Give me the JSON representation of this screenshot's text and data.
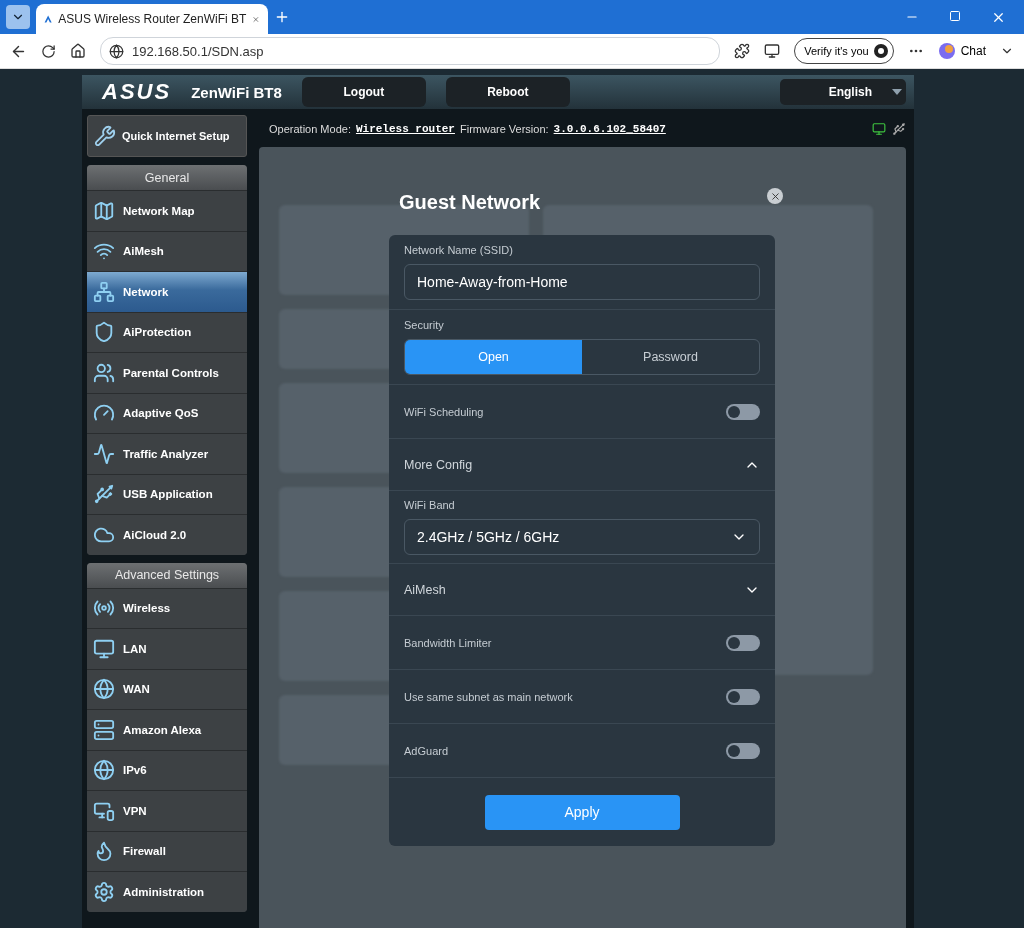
{
  "browser": {
    "tab_title": "ASUS Wireless Router ZenWiFi BT",
    "url": "192.168.50.1/SDN.asp",
    "verify": "Verify it's you",
    "chat": "Chat"
  },
  "header": {
    "logo": "ASUS",
    "model": "ZenWiFi BT8",
    "buttons": [
      "Logout",
      "Reboot"
    ],
    "language": "English"
  },
  "status": {
    "mode_label": "Operation Mode:",
    "mode": "Wireless router",
    "firmware_label": "Firmware Version:",
    "firmware": "3.0.0.6.102_58407"
  },
  "sidebar": {
    "quick_setup": "Quick Internet Setup",
    "sections": [
      {
        "title": "General",
        "items": [
          {
            "label": "Network Map",
            "selected": false
          },
          {
            "label": "AiMesh",
            "selected": false
          },
          {
            "label": "Network",
            "selected": true
          },
          {
            "label": "AiProtection",
            "selected": false
          },
          {
            "label": "Parental Controls",
            "selected": false
          },
          {
            "label": "Adaptive QoS",
            "selected": false
          },
          {
            "label": "Traffic Analyzer",
            "selected": false
          },
          {
            "label": "USB Application",
            "selected": false
          },
          {
            "label": "AiCloud 2.0",
            "selected": false
          }
        ]
      },
      {
        "title": "Advanced Settings",
        "items": [
          {
            "label": "Wireless",
            "selected": false
          },
          {
            "label": "LAN",
            "selected": false
          },
          {
            "label": "WAN",
            "selected": false
          },
          {
            "label": "Amazon Alexa",
            "selected": false
          },
          {
            "label": "IPv6",
            "selected": false
          },
          {
            "label": "VPN",
            "selected": false
          },
          {
            "label": "Firewall",
            "selected": false
          },
          {
            "label": "Administration",
            "selected": false
          }
        ]
      }
    ]
  },
  "modal": {
    "title": "Guest Network",
    "rows": [
      {
        "kind": "input",
        "label": "Network Name (SSID)",
        "value": "Home-Away-from-Home"
      },
      {
        "kind": "segment",
        "label": "Security",
        "options": [
          {
            "label": "Open",
            "selected": true
          },
          {
            "label": "Password",
            "selected": false
          }
        ]
      },
      {
        "kind": "toggle",
        "label": "WiFi Scheduling",
        "on": false
      },
      {
        "kind": "expander",
        "label": "More Config",
        "expanded": true
      },
      {
        "kind": "select",
        "label": "WiFi Band",
        "value": "2.4GHz / 5GHz / 6GHz"
      },
      {
        "kind": "expander",
        "label": "AiMesh",
        "expanded": false
      },
      {
        "kind": "toggle",
        "label": "Bandwidth Limiter",
        "on": false
      },
      {
        "kind": "toggle",
        "label": "Use same subnet as main network",
        "on": false
      },
      {
        "kind": "toggle",
        "label": "AdGuard",
        "on": false
      }
    ],
    "apply": "Apply"
  }
}
